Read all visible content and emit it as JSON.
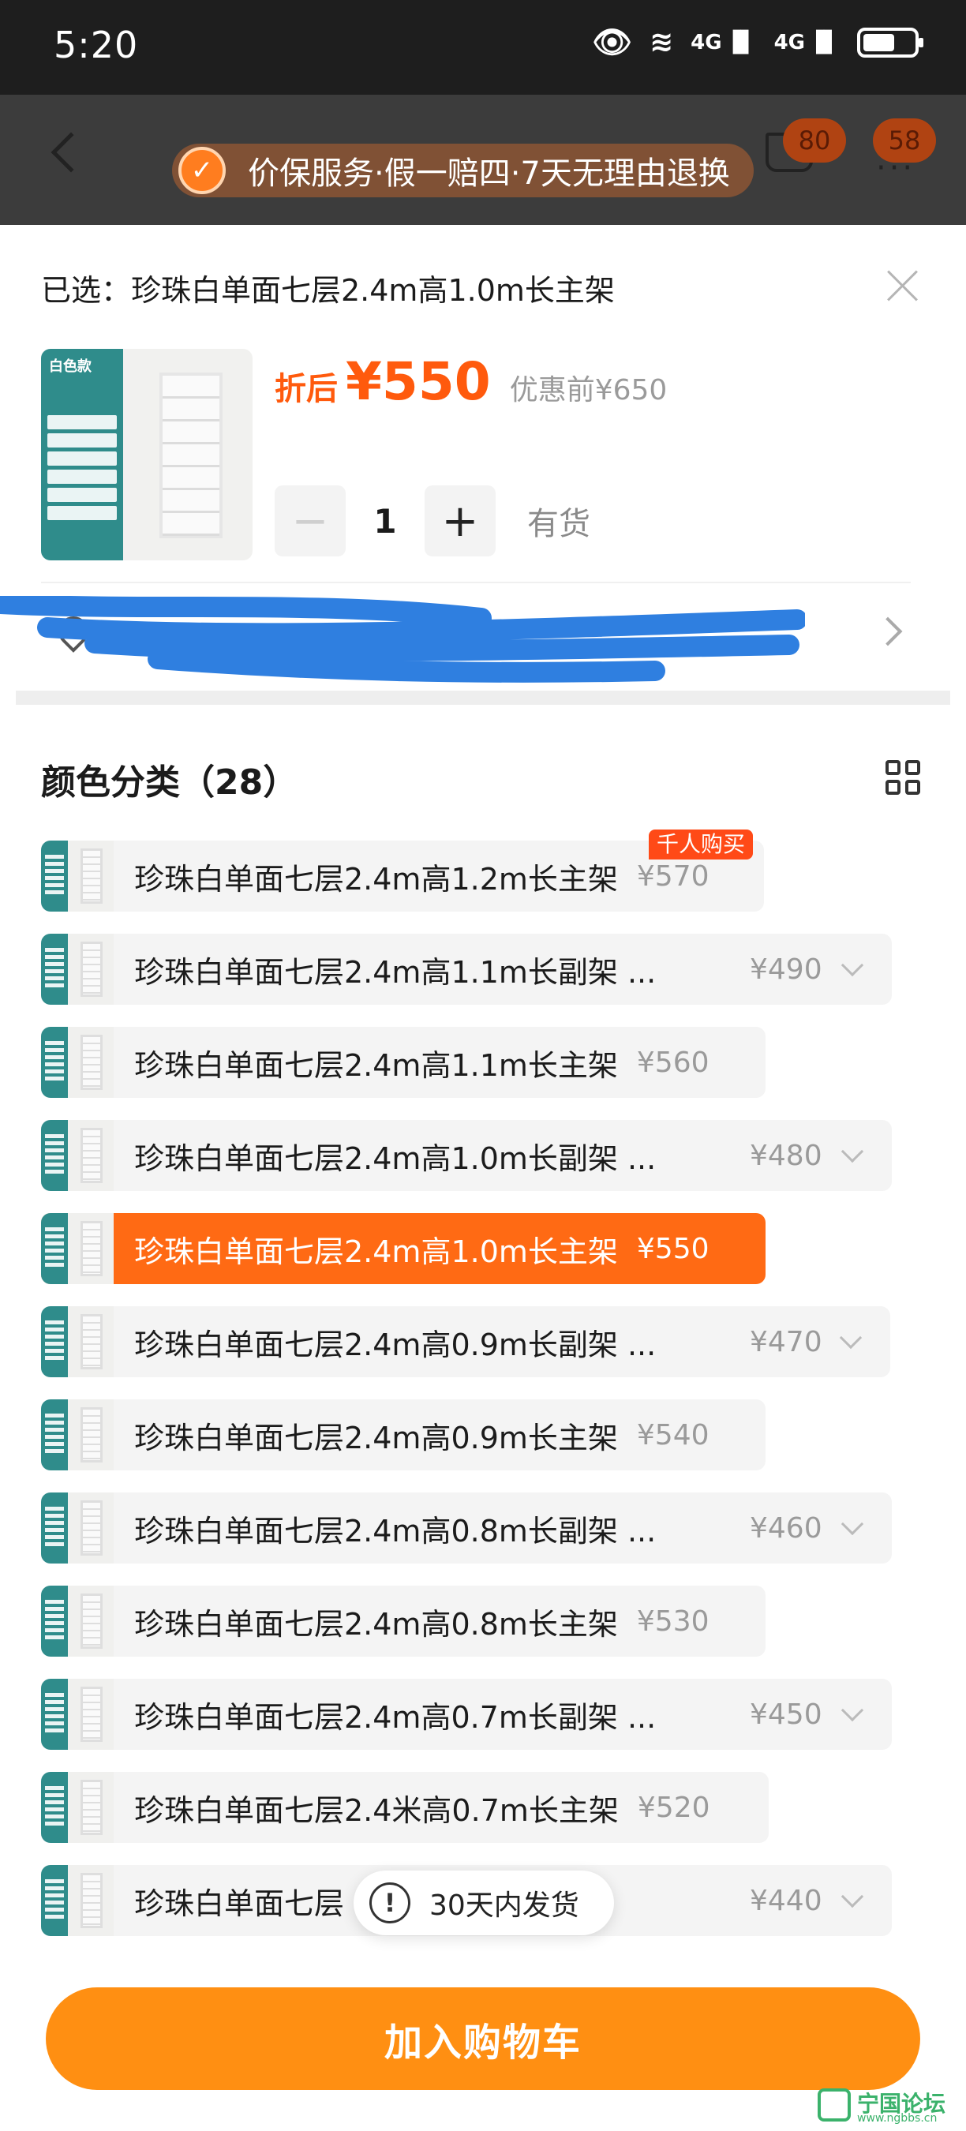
{
  "status_bar": {
    "time": "5:20",
    "network_1": "4G",
    "network_2": "4G"
  },
  "header": {
    "cart_badge": "80",
    "message_badge": "58",
    "search_ghost": "",
    "guarantee_banner": "价保服务·假一赔四·7天无理由退换"
  },
  "sheet": {
    "selected_label": "已选：珍珠白单面七层2.4m高1.0m长主架",
    "thumb_tag": "白色款",
    "price_prefix": "折后",
    "price_current": "¥550",
    "price_before": "优惠前¥650",
    "quantity": "1",
    "stock_status": "有货",
    "address_text": "",
    "section_title": "颜色分类（28）",
    "popular_tag": "千人购买"
  },
  "options": [
    {
      "name": "珍珠白单面七层2.4m高1.2m长主架",
      "price": "¥570"
    },
    {
      "name": "珍珠白单面七层2.4m高1.1m长副架 ...",
      "price": "¥490"
    },
    {
      "name": "珍珠白单面七层2.4m高1.1m长主架",
      "price": "¥560"
    },
    {
      "name": "珍珠白单面七层2.4m高1.0m长副架 ...",
      "price": "¥480"
    },
    {
      "name": "珍珠白单面七层2.4m高1.0m长主架",
      "price": "¥550"
    },
    {
      "name": "珍珠白单面七层2.4m高0.9m长副架 ...",
      "price": "¥470"
    },
    {
      "name": "珍珠白单面七层2.4m高0.9m长主架",
      "price": "¥540"
    },
    {
      "name": "珍珠白单面七层2.4m高0.8m长副架 ...",
      "price": "¥460"
    },
    {
      "name": "珍珠白单面七层2.4m高0.8m长主架",
      "price": "¥530"
    },
    {
      "name": "珍珠白单面七层2.4m高0.7m长副架 ...",
      "price": "¥450"
    },
    {
      "name": "珍珠白单面七层2.4米高0.7m长主架",
      "price": "¥520"
    },
    {
      "name": "珍珠白单面七层",
      "price": "¥440"
    }
  ],
  "toast": {
    "text": "30天内发货"
  },
  "footer": {
    "add_to_cart": "加入购物车"
  },
  "watermark": {
    "text": "宁国论坛",
    "url": "www.ngbbs.cn"
  },
  "colors": {
    "accent_orange": "#ff6a14",
    "button_orange": "#ff8f12",
    "teal_panel": "#2f8c8b"
  }
}
